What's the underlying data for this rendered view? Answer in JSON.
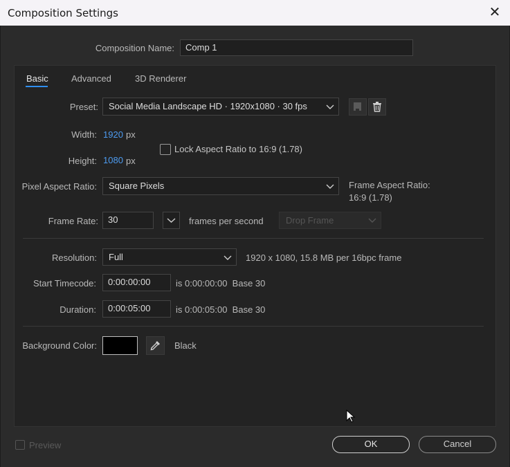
{
  "window": {
    "title": "Composition Settings",
    "close_symbol": "✕"
  },
  "composition_name": {
    "label": "Composition Name:",
    "value": "Comp 1"
  },
  "tabs": [
    {
      "label": "Basic",
      "active": true
    },
    {
      "label": "Advanced",
      "active": false
    },
    {
      "label": "3D Renderer",
      "active": false
    }
  ],
  "preset": {
    "label": "Preset:",
    "value": "Social Media Landscape HD  ·  1920x1080 · 30 fps"
  },
  "width": {
    "label": "Width:",
    "value": "1920",
    "unit": "px"
  },
  "height": {
    "label": "Height:",
    "value": "1080",
    "unit": "px"
  },
  "lock_aspect": {
    "label": "Lock Aspect Ratio to 16:9 (1.78)",
    "checked": false
  },
  "pixel_aspect": {
    "label": "Pixel Aspect Ratio:",
    "value": "Square Pixels"
  },
  "frame_aspect": {
    "label": "Frame Aspect Ratio:",
    "value": "16:9 (1.78)"
  },
  "frame_rate": {
    "label": "Frame Rate:",
    "value": "30",
    "unit": "frames per second",
    "drop_frame": "Drop Frame"
  },
  "resolution": {
    "label": "Resolution:",
    "value": "Full",
    "info": "1920 x 1080, 15.8 MB per 16bpc frame"
  },
  "start_timecode": {
    "label": "Start Timecode:",
    "value": "0:00:00:00",
    "info": "is 0:00:00:00  Base 30"
  },
  "duration": {
    "label": "Duration:",
    "value": "0:00:05:00",
    "info": "is 0:00:05:00  Base 30"
  },
  "background_color": {
    "label": "Background Color:",
    "name": "Black",
    "swatch": "#000000"
  },
  "footer": {
    "preview_label": "Preview",
    "ok_label": "OK",
    "cancel_label": "Cancel"
  },
  "colors": {
    "accent": "#2f8ef0",
    "value_blue": "#4d9bf0"
  },
  "icons": {
    "save_preset": "save-preset-icon",
    "delete_preset": "trash-icon",
    "eyedropper": "eyedropper-icon"
  }
}
